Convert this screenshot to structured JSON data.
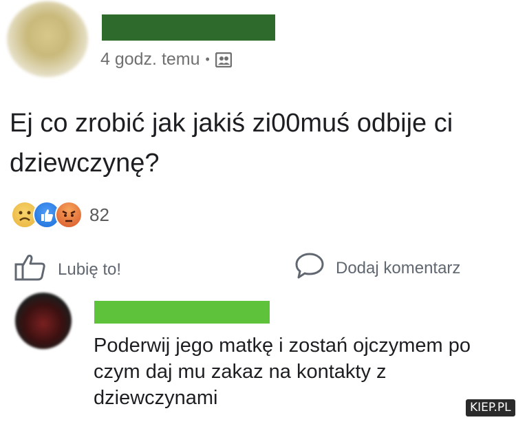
{
  "post": {
    "timestamp": "4 godz. temu",
    "separator": "•",
    "audience_icon": "friends-icon",
    "text": "Ej co zrobić jak jakiś zi00muś odbije ci dziewczynę?",
    "reactions": {
      "icons": [
        "sad-reaction-icon",
        "like-reaction-icon",
        "angry-reaction-icon"
      ],
      "count": "82"
    }
  },
  "actions": {
    "like_label": "Lubię to!",
    "comment_label": "Dodaj komentarz"
  },
  "comment": {
    "text": "Poderwij jego matkę i zostań ojczymem po czym daj mu zakaz na kontakty z dziewczynami"
  },
  "watermark": {
    "text": "KIEP.PL"
  },
  "colors": {
    "author_redaction": "#2e6a2c",
    "commenter_redaction": "#5ec23a",
    "meta_text": "#707070"
  }
}
